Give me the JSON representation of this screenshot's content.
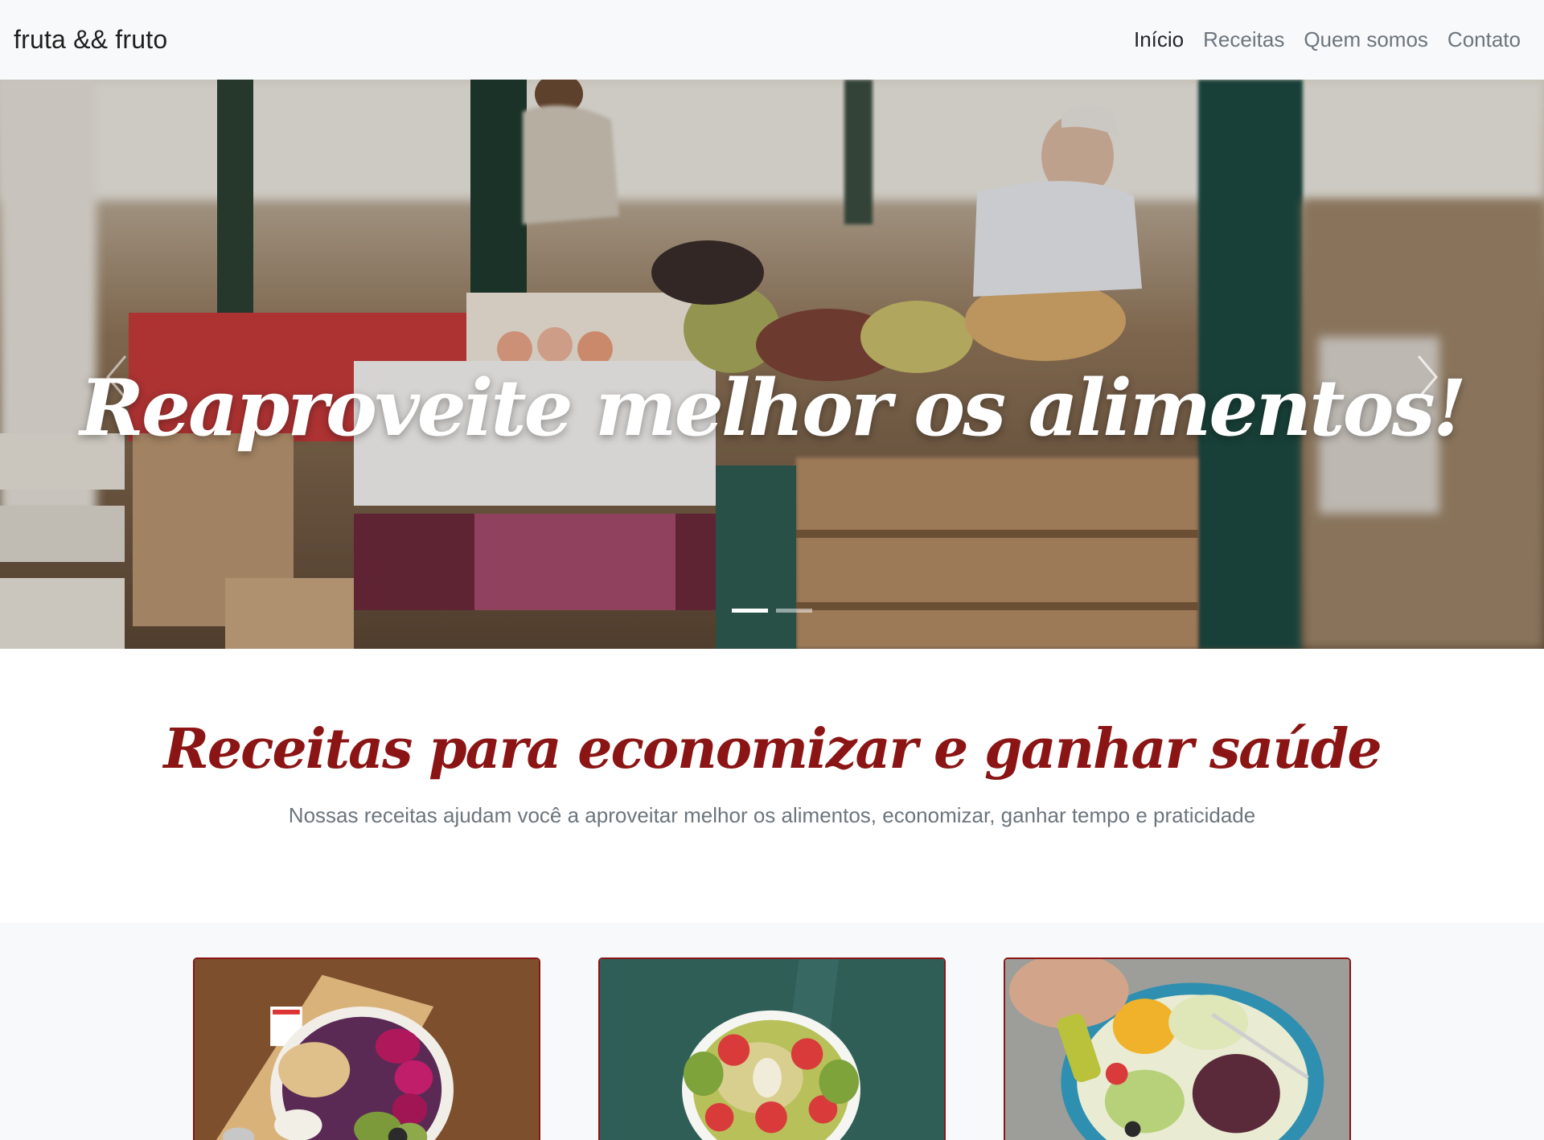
{
  "navbar": {
    "brand": "fruta && fruto",
    "links": [
      "Início",
      "Receitas",
      "Quem somos",
      "Contato"
    ],
    "active_index": 0
  },
  "hero": {
    "title": "Reaproveite melhor os alimentos!",
    "slides_count": 2,
    "active_slide": 0
  },
  "section": {
    "title": "Receitas para economizar e ganhar saúde",
    "subtitle": "Nossas receitas ajudam você a aproveitar melhor os alimentos, economizar, ganhar tempo e praticidade"
  },
  "colors": {
    "accent": "#8b1414",
    "navbar_bg": "#f8f9fa",
    "muted_text": "#6c757d"
  }
}
